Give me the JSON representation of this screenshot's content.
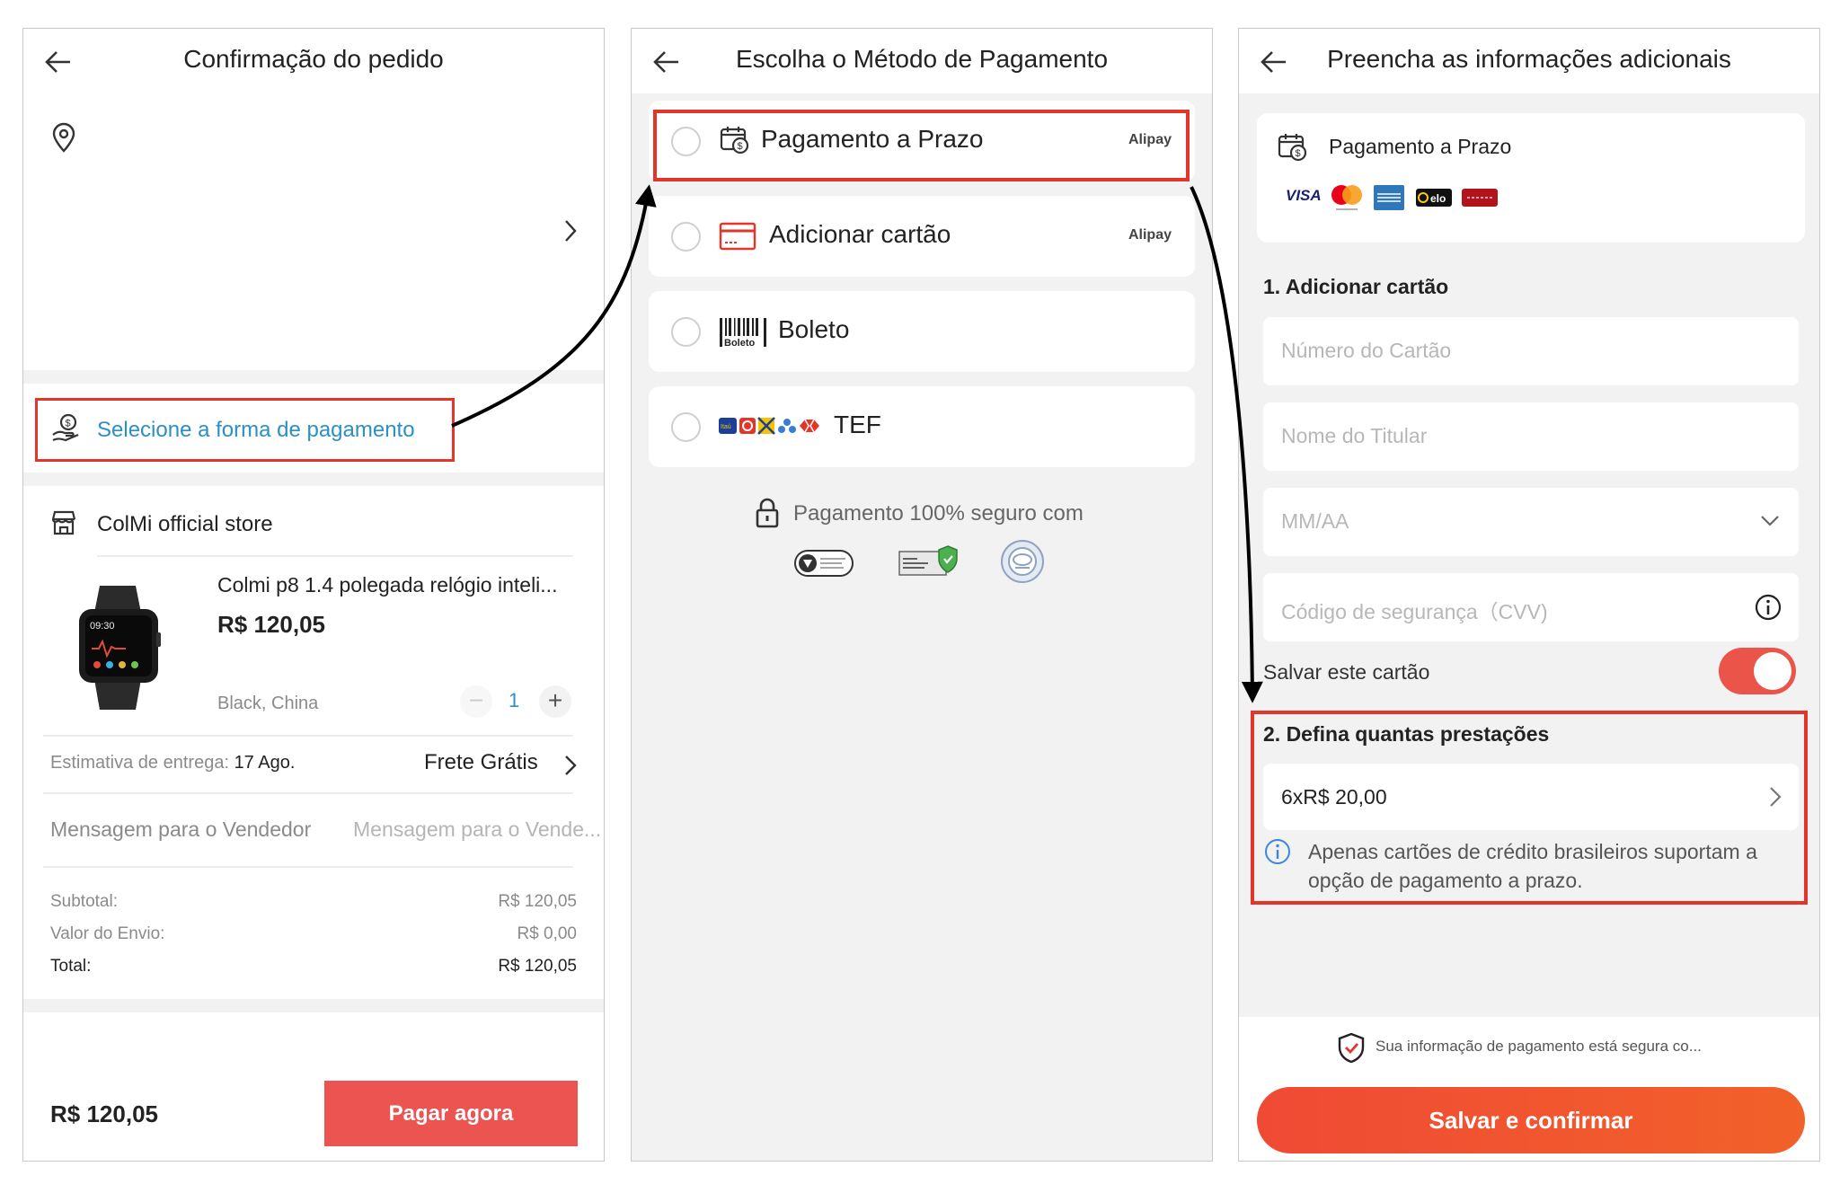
{
  "colors": {
    "accent_red": "#e2362a",
    "link_blue": "#2c8fc6",
    "button_red": "#ec5451",
    "toggle_red": "#eb5448"
  },
  "panel1": {
    "title": "Confirmação do pedido",
    "payment_select": "Selecione a forma de pagamento",
    "store": "ColMi official store",
    "product_name": "Colmi p8 1.4 polegada relógio inteli...",
    "product_price": "R$ 120,05",
    "variant": "Black, China",
    "quantity": "1",
    "delivery_label": "Estimativa de entrega:",
    "delivery_date": "17 Ago.",
    "shipping": "Frete Grátis",
    "message_label": "Mensagem para o Vendedor",
    "message_placeholder": "Mensagem para o Vende...",
    "subtotal_label": "Subtotal:",
    "subtotal_value": "R$ 120,05",
    "shipping_cost_label": "Valor do Envio:",
    "shipping_cost_value": "R$ 0,00",
    "total_label": "Total:",
    "total_value": "R$ 120,05",
    "footer_total": "R$ 120,05",
    "pay_now": "Pagar agora",
    "watch_time": "09:30"
  },
  "panel2": {
    "title": "Escolha o Método de Pagamento",
    "options": [
      {
        "label": "Pagamento a Prazo",
        "provider": "Alipay",
        "icon": "calendar-money-icon"
      },
      {
        "label": "Adicionar cartão",
        "provider": "Alipay",
        "icon": "credit-card-icon"
      },
      {
        "label": "Boleto",
        "provider": "",
        "icon": "barcode-icon",
        "icon_text": "Boleto"
      },
      {
        "label": "TEF",
        "provider": "",
        "icon": "bank-logos-icon",
        "icon_text": "Itaú"
      }
    ],
    "secure_text": "Pagamento 100% seguro com",
    "badges": [
      "pci-badge",
      "ssl-badge",
      "iso-badge"
    ]
  },
  "panel3": {
    "title": "Preencha as informações adicionais",
    "method": "Pagamento a Prazo",
    "card_brands": [
      "VISA",
      "mastercard",
      "amex",
      "elo",
      "hipercard"
    ],
    "section1": "1. Adicionar cartão",
    "card_number_ph": "Número do Cartão",
    "holder_ph": "Nome do Titular",
    "expiry_ph": "MM/AA",
    "cvv_ph": "Código de segurança（CVV)",
    "save_card": "Salvar este cartão",
    "save_card_on": true,
    "section2": "2. Defina quantas prestações",
    "installment": "6xR$ 20,00",
    "info_line1": "Apenas cartões de crédito brasileiros suportam a",
    "info_line2": "opção de pagamento a prazo.",
    "security_note": "Sua informação de pagamento está segura co...",
    "confirm": "Salvar e confirmar"
  }
}
